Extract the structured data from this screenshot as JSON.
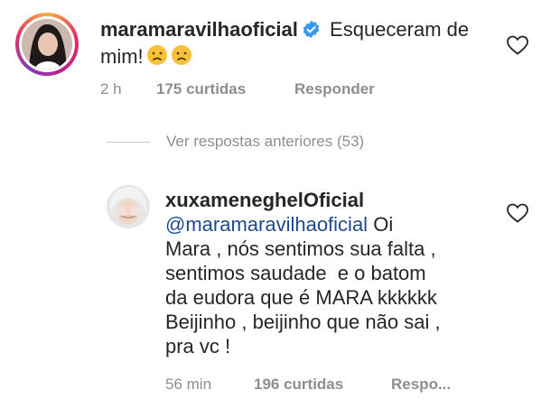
{
  "comments": [
    {
      "username": "maramaravilhaoficial",
      "verified": true,
      "text": "Esqueceram de mim!",
      "emoji": "😞😞",
      "time": "2 h",
      "likes": "175 curtidas",
      "reply": "Responder"
    },
    {
      "username": "xuxameneghelOficial",
      "mention": "@maramaravilhaoficial",
      "text_line1": "Oi",
      "text_line2": "Mara , nós sentimos sua falta ,",
      "text_line3": "sentimos saudade  e o batom",
      "text_line4": "da eudora que é MARA kkkkkk",
      "text_line5": "Beijinho , beijinho que não sai ,",
      "text_line6": "pra vc !",
      "time": "56 min",
      "likes": "196 curtidas",
      "reply": "Respo..."
    }
  ],
  "view_replies": "Ver respostas anteriores (53)",
  "colors": {
    "text": "#262626",
    "meta": "#8e8e8e",
    "mention": "#1f4a8a",
    "verified": "#3897f0"
  },
  "icons": {
    "like": "heart-outline-icon",
    "verified": "verified-badge-icon"
  }
}
